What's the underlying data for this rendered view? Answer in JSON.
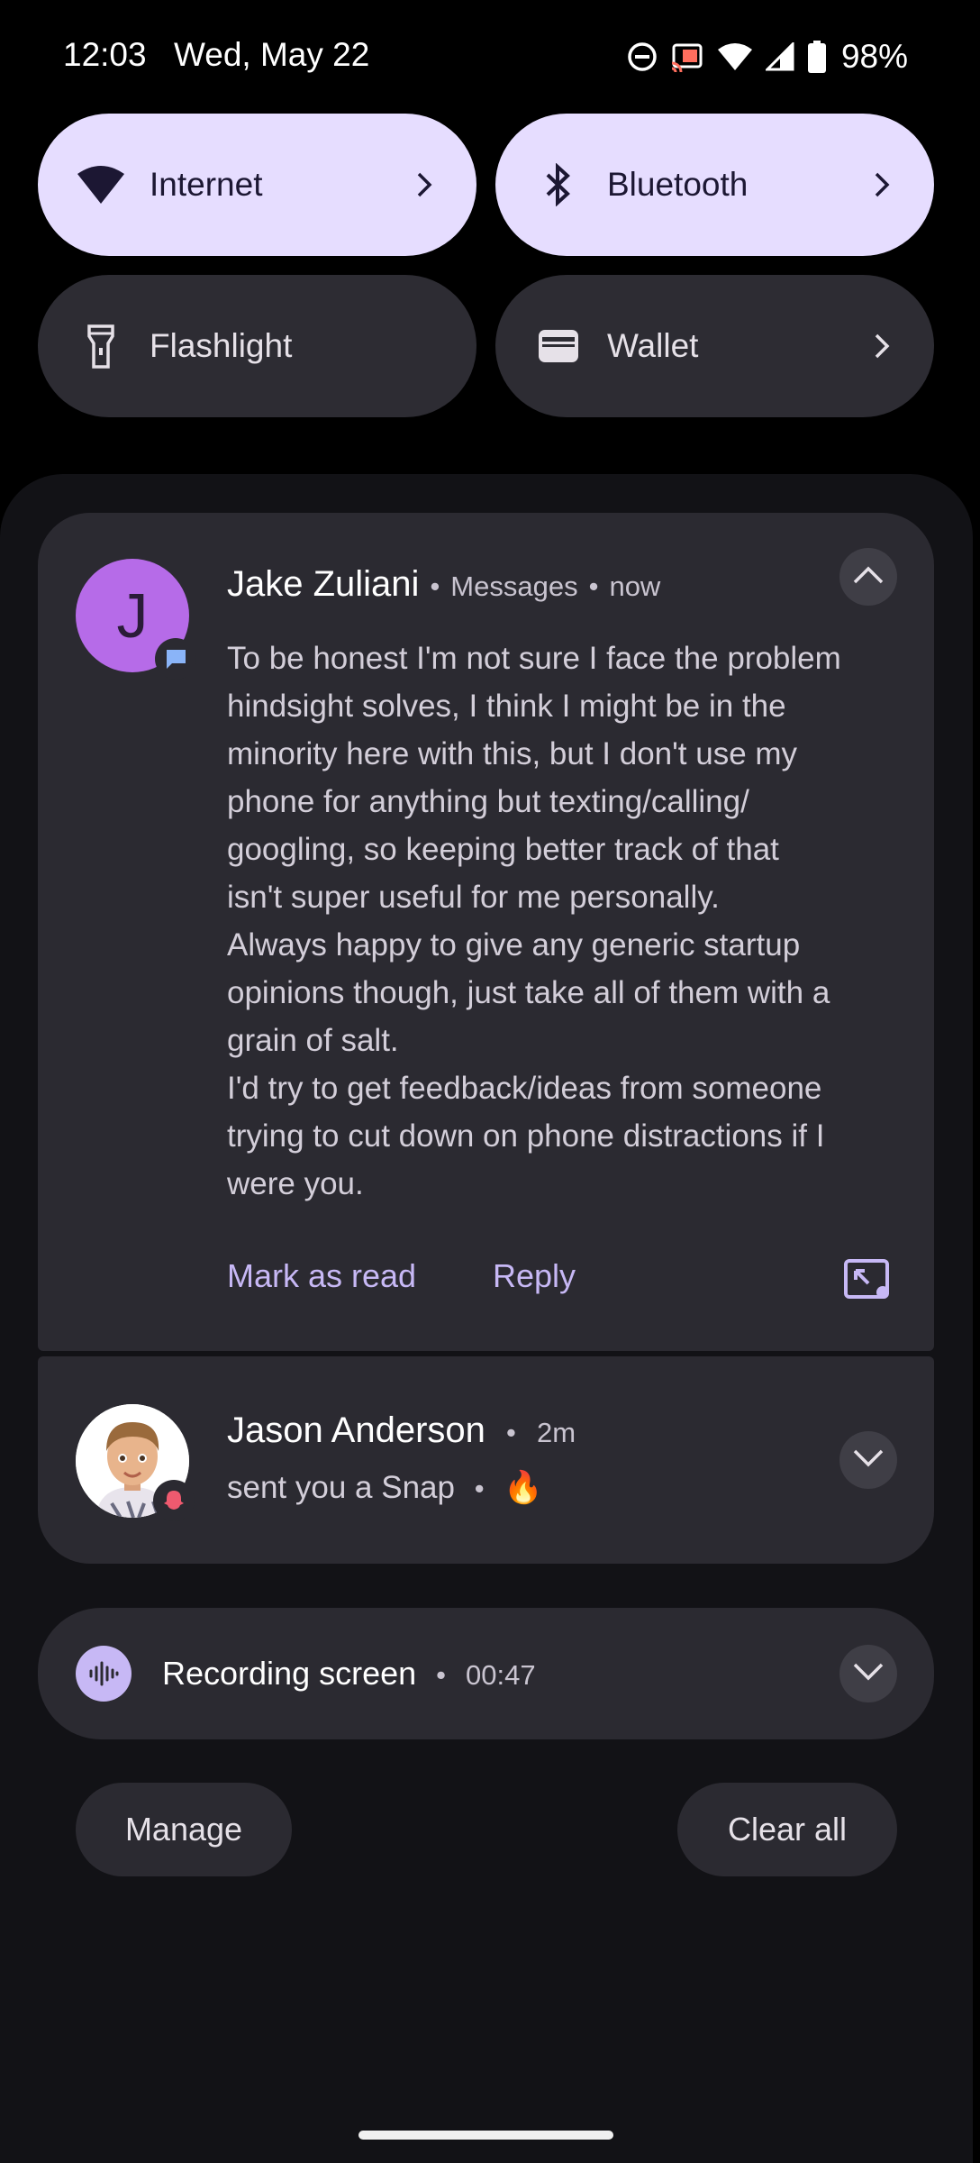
{
  "status_bar": {
    "time": "12:03",
    "date": "Wed, May 22",
    "battery": "98%",
    "icons": [
      "do-not-disturb-icon",
      "cast-icon",
      "wifi-icon",
      "cellular-signal-icon",
      "battery-icon"
    ]
  },
  "quick_settings": {
    "tiles": [
      {
        "label": "Internet",
        "icon": "wifi-icon",
        "active": true,
        "has_chevron": true
      },
      {
        "label": "Bluetooth",
        "icon": "bluetooth-icon",
        "active": true,
        "has_chevron": true
      },
      {
        "label": "Flashlight",
        "icon": "flashlight-icon",
        "active": false,
        "has_chevron": false
      },
      {
        "label": "Wallet",
        "icon": "wallet-icon",
        "active": false,
        "has_chevron": true
      }
    ]
  },
  "notifications": {
    "message": {
      "avatar_letter": "J",
      "sender": "Jake Zuliani",
      "app": "Messages",
      "time": "now",
      "body_lines": [
        "To be honest I'm not sure I face the problem",
        "hindsight solves, I think I might be in the",
        "minority here with this, but I don't use my",
        "phone for anything but texting/calling/",
        "googling, so keeping better track of that",
        "isn't super useful for me personally.",
        "Always happy to give any generic startup",
        "opinions though, just take all of them with a",
        "grain of salt.",
        "I'd try to get feedback/ideas from someone",
        "trying to cut down on phone distractions if I",
        "were you."
      ],
      "actions": {
        "mark_read": "Mark as read",
        "reply": "Reply"
      }
    },
    "snap": {
      "sender": "Jason Anderson",
      "time": "2m",
      "text": "sent you a Snap",
      "emoji": "🔥"
    },
    "recording": {
      "title": "Recording screen",
      "elapsed": "00:47"
    }
  },
  "footer": {
    "manage_label": "Manage",
    "clear_all_label": "Clear all"
  },
  "colors": {
    "tile_active": "#e6ddff",
    "tile_inactive": "#2d2c33",
    "card": "#2b2a31",
    "accent": "#c7b8f5",
    "avatar_j": "#b66be8"
  }
}
